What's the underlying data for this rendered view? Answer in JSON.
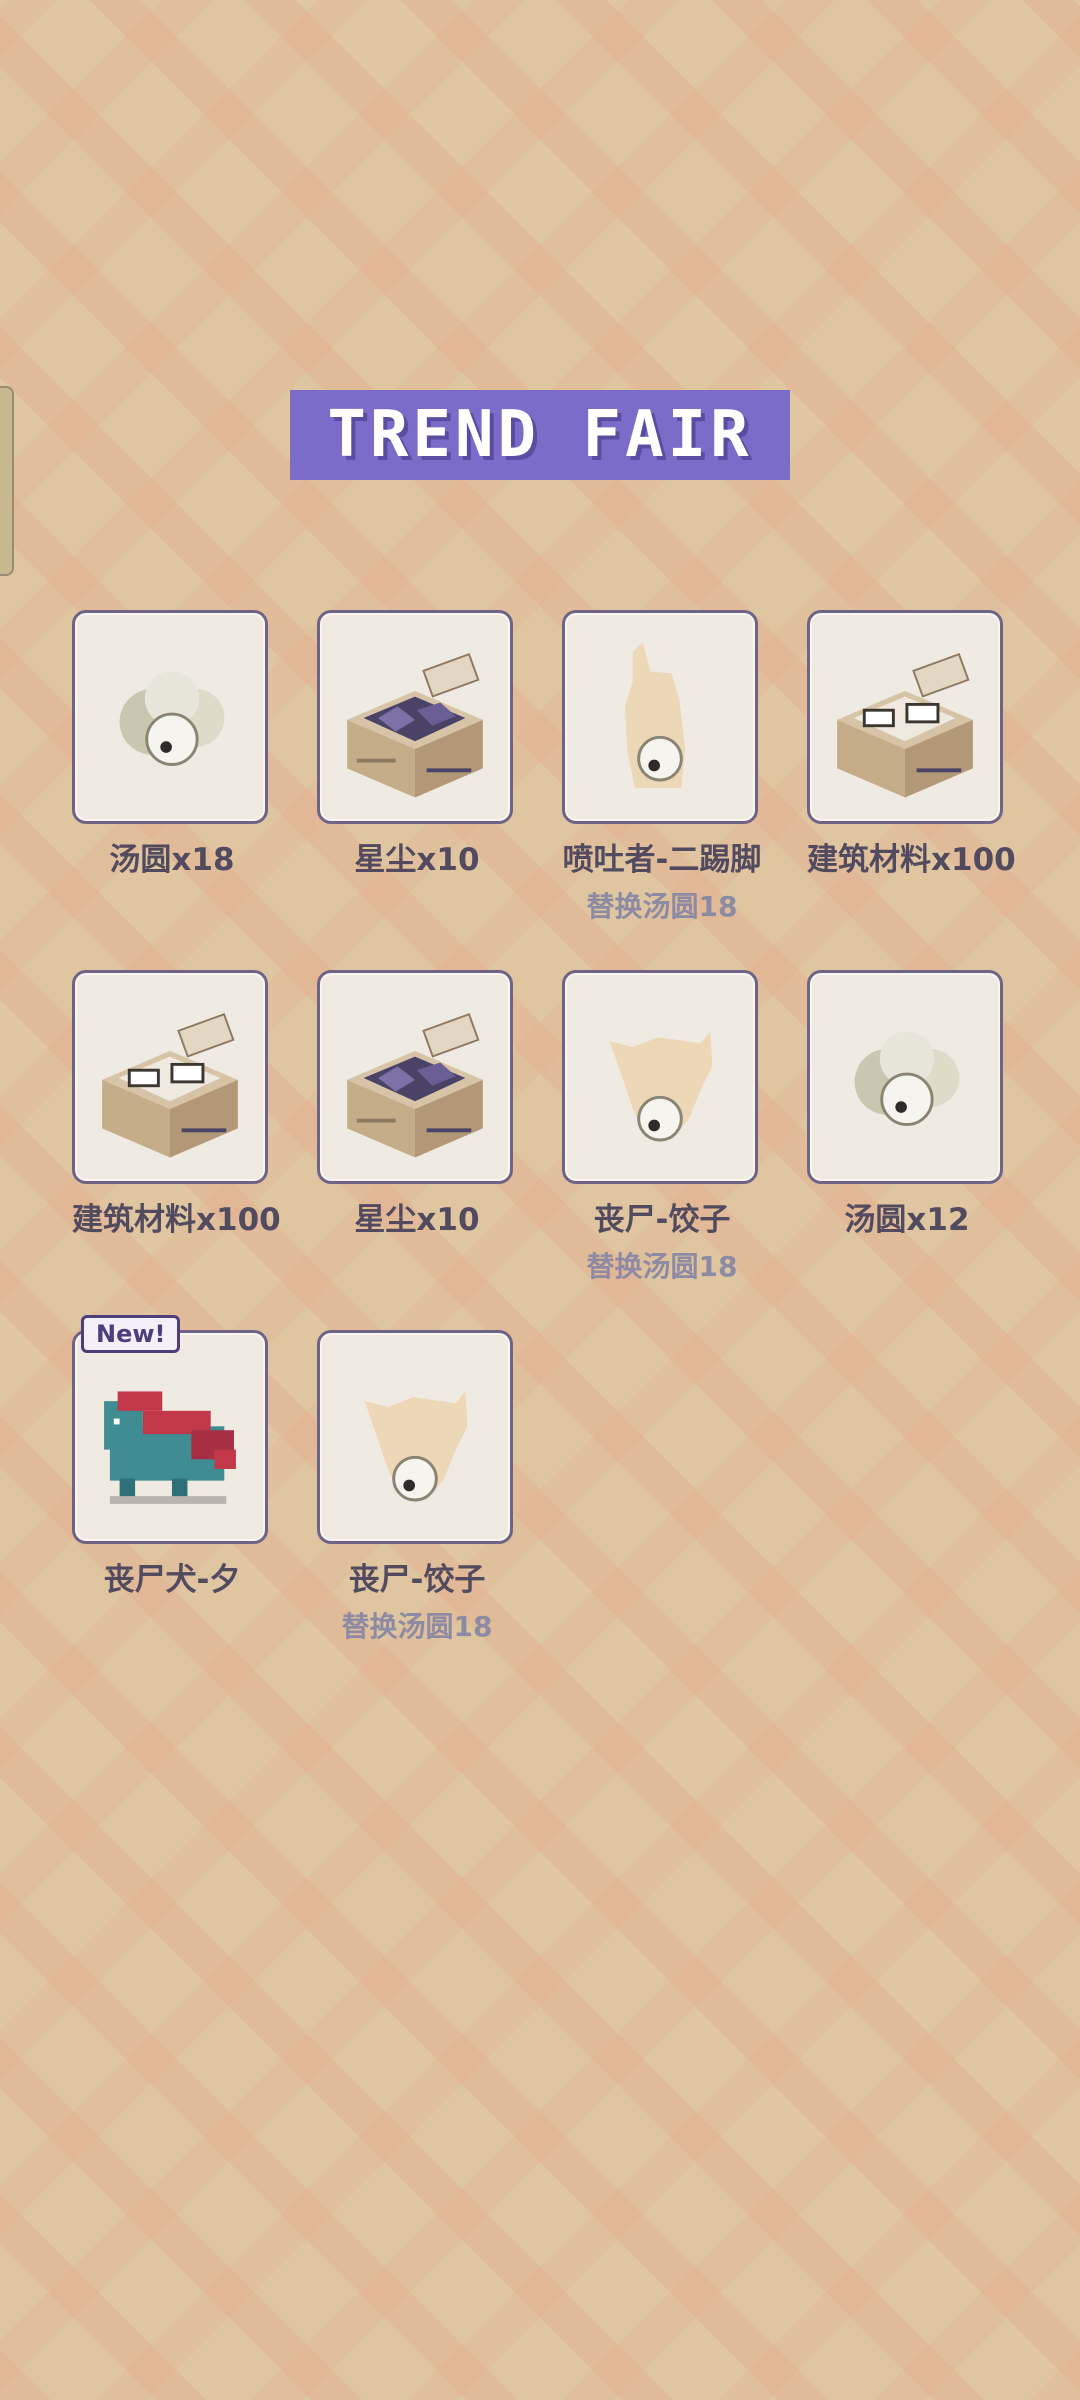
{
  "title": "TREND FAIR",
  "colors": {
    "banner": "#7c6cc9",
    "card_border": "#6f6486",
    "background": "#dfc6a1"
  },
  "items": [
    {
      "name": "汤圆x18",
      "sub": "",
      "icon": "tangyuan-icon",
      "badge": ""
    },
    {
      "name": "星尘x10",
      "sub": "",
      "icon": "stardust-crate-icon",
      "badge": ""
    },
    {
      "name": "喷吐者-二踢脚",
      "sub": "替换汤圆18",
      "icon": "silhouette-pet-icon",
      "badge": ""
    },
    {
      "name": "建筑材料x100",
      "sub": "",
      "icon": "building-materials-crate-icon",
      "badge": ""
    },
    {
      "name": "建筑材料x100",
      "sub": "",
      "icon": "building-materials-crate-icon",
      "badge": ""
    },
    {
      "name": "星尘x10",
      "sub": "",
      "icon": "stardust-crate-icon",
      "badge": ""
    },
    {
      "name": "丧尸-饺子",
      "sub": "替换汤圆18",
      "icon": "silhouette-pet-icon",
      "badge": ""
    },
    {
      "name": "汤圆x12",
      "sub": "",
      "icon": "tangyuan-icon",
      "badge": ""
    },
    {
      "name": "丧尸犬-夕",
      "sub": "",
      "icon": "zombie-dog-icon",
      "badge": "New!"
    },
    {
      "name": "丧尸-饺子",
      "sub": "替换汤圆18",
      "icon": "silhouette-pet-icon",
      "badge": ""
    }
  ]
}
